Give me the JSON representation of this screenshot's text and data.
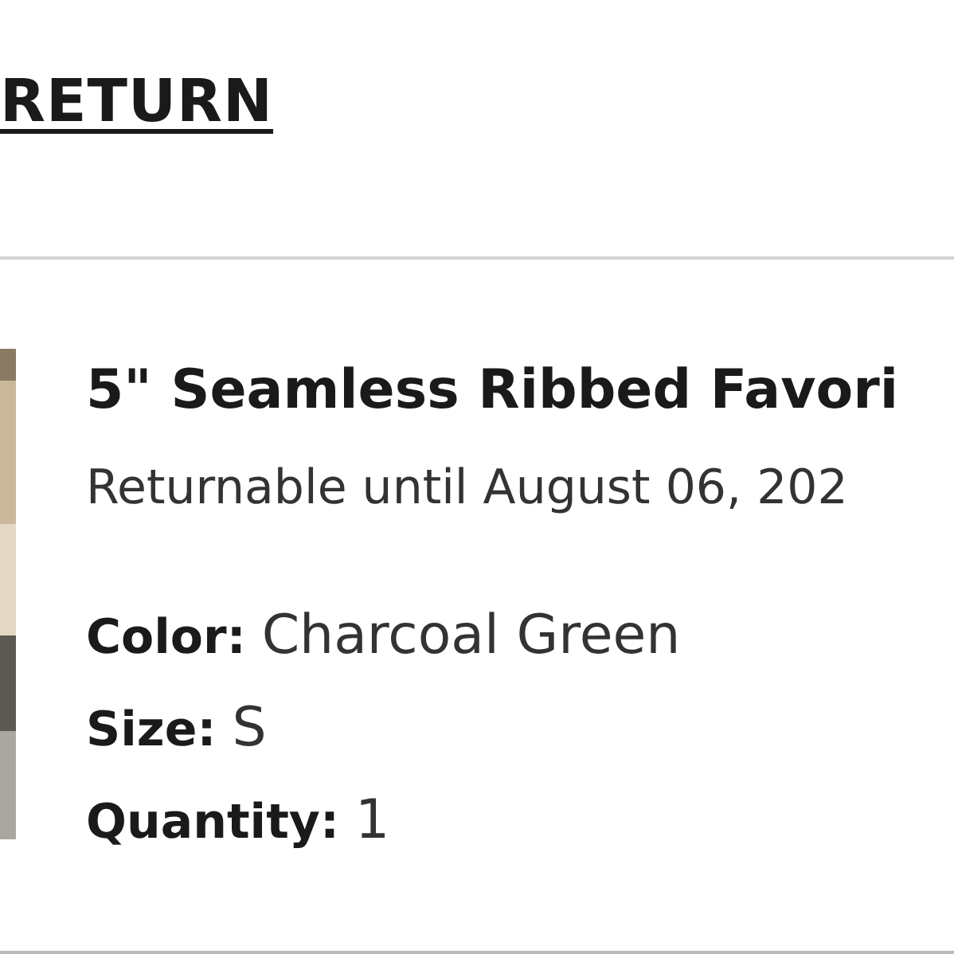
{
  "heading": "RETURN",
  "item": {
    "title": "5\" Seamless Ribbed Favori",
    "return_note": "Returnable until August 06, 202",
    "attributes": [
      {
        "label": "Color:",
        "value": "Charcoal Green"
      },
      {
        "label": "Size:",
        "value": "S"
      },
      {
        "label": "Quantity:",
        "value": "1"
      }
    ]
  }
}
